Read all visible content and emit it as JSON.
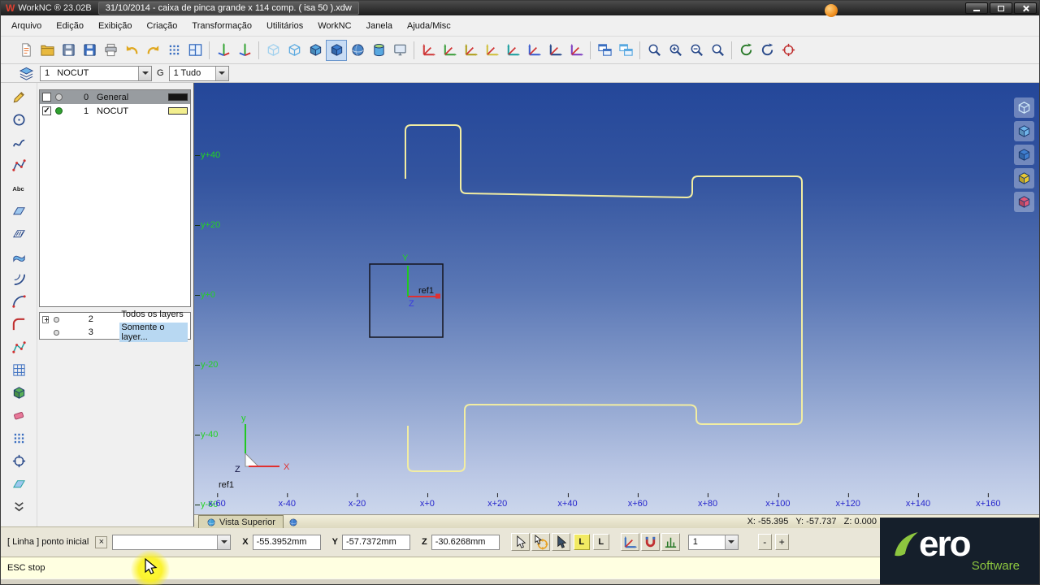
{
  "window": {
    "app_icon_glyph": "W",
    "app_title": "WorkNC ® 23.02B",
    "doc_title": "31/10/2014 - caixa de pinca grande x 114 comp. ( isa 50 ).xdw"
  },
  "menu": {
    "items": [
      "Arquivo",
      "Edição",
      "Exibição",
      "Criação",
      "Transformação",
      "Utilitários",
      "WorkNC",
      "Janela",
      "Ajuda/Misc"
    ]
  },
  "toolbar_main": {
    "icons": [
      {
        "n": "new-file-button",
        "s": "page",
        "c": "#e86820"
      },
      {
        "n": "open-file-button",
        "s": "folder",
        "c": "#e8b93e"
      },
      {
        "n": "save-as-button",
        "s": "floppy",
        "c": "#7a8ca8"
      },
      {
        "n": "save-button",
        "s": "floppy",
        "c": "#3a6ec0"
      },
      {
        "n": "print-button",
        "s": "printer",
        "c": "#b9bec6"
      },
      {
        "n": "undo-button",
        "s": "undo",
        "c": "#e0a820"
      },
      {
        "n": "redo-button",
        "s": "redo",
        "c": "#e0a820"
      },
      {
        "n": "snap-grid-button",
        "s": "dotgrid",
        "c": "#3a6ec0"
      },
      {
        "n": "viewport-layout-button",
        "s": "layout",
        "c": "#3a6ec0"
      },
      {
        "sep": true
      },
      {
        "n": "axes-xyz-button",
        "s": "axes",
        "c": "#333333"
      },
      {
        "n": "axes-uvw-button",
        "s": "axes",
        "c": "#555555"
      },
      {
        "sep": true
      },
      {
        "n": "view-wireframe-button",
        "s": "cubewire",
        "c": "#9fd0ee"
      },
      {
        "n": "view-hidden-line-button",
        "s": "cubewire",
        "c": "#58a8e0"
      },
      {
        "n": "view-shaded-button",
        "s": "cube",
        "c": "#58a8e0"
      },
      {
        "n": "view-shaded-edges-button",
        "s": "cube",
        "c": "#3f7fd0",
        "pressed": true
      },
      {
        "n": "view-sphere-button",
        "s": "sphere",
        "c": "#4a86c8"
      },
      {
        "n": "view-cylinder-button",
        "s": "cyl",
        "c": "#58a8e0"
      },
      {
        "n": "view-screen-button",
        "s": "screen",
        "c": "#667788"
      },
      {
        "sep": true
      },
      {
        "n": "transform-translate-button",
        "s": "axes2",
        "c": "#d04040"
      },
      {
        "n": "transform-rotate-button",
        "s": "axes2",
        "c": "#40a040"
      },
      {
        "n": "transform-scale-button",
        "s": "axes2",
        "c": "#b0a020"
      },
      {
        "n": "transform-mirror-button",
        "s": "axes2",
        "c": "#d0c040"
      },
      {
        "n": "transform-project-button",
        "s": "axes2",
        "c": "#20a0a0"
      },
      {
        "n": "transform-align-button",
        "s": "axes2",
        "c": "#4060d0"
      },
      {
        "n": "transform-array-button",
        "s": "axes2",
        "c": "#2a4a8a"
      },
      {
        "n": "transform-offset-button",
        "s": "axes2",
        "c": "#8040c0"
      },
      {
        "sep": true
      },
      {
        "n": "window-tile-button",
        "s": "winpair",
        "c": "#3a6ec0"
      },
      {
        "n": "window-new-button",
        "s": "winpair",
        "c": "#58a8e0"
      },
      {
        "sep": true
      },
      {
        "n": "zoom-window-button",
        "s": "zoom",
        "c": "#2a4a8a"
      },
      {
        "n": "zoom-in-button",
        "s": "zoomin",
        "c": "#2a4a8a"
      },
      {
        "n": "zoom-out-button",
        "s": "zoomout",
        "c": "#2a4a8a"
      },
      {
        "n": "zoom-fit-button",
        "s": "zoom",
        "c": "#2a4a8a"
      },
      {
        "sep": true
      },
      {
        "n": "rotate-view-button",
        "s": "rotate",
        "c": "#2a7a2a"
      },
      {
        "n": "spin-view-button",
        "s": "rotate",
        "c": "#2a4a8a"
      },
      {
        "n": "center-view-button",
        "s": "target",
        "c": "#c03030"
      }
    ]
  },
  "layer_bar": {
    "layer_value": "1   NOCUT",
    "group_label": "G",
    "group_value": "1 Tudo"
  },
  "left_tools": {
    "icons": [
      {
        "n": "pencil-tool",
        "s": "pencil",
        "c": "#806020"
      },
      {
        "n": "circle-tool",
        "s": "circlet",
        "c": "#2a4a8a"
      },
      {
        "n": "spline-tool",
        "s": "spline",
        "c": "#2a4a8a"
      },
      {
        "n": "polyline-tool",
        "s": "polyline",
        "c": "#2a4a8a"
      },
      {
        "n": "text-tool",
        "s": "abc",
        "c": "#222222"
      },
      {
        "n": "plane-tool",
        "s": "plane",
        "c": "#2a4a8a"
      },
      {
        "n": "hatch-tool",
        "s": "hatch",
        "c": "#2a4a8a"
      },
      {
        "n": "surface-tool",
        "s": "wave",
        "c": "#2a4a8a"
      },
      {
        "n": "offset-tool",
        "s": "offset",
        "c": "#2a4a8a"
      },
      {
        "n": "arc-tool",
        "s": "arc",
        "c": "#2a4a8a"
      },
      {
        "n": "fillet-tool",
        "s": "fillet",
        "c": "#c03030"
      },
      {
        "n": "trim-tool",
        "s": "polyline",
        "c": "#20a0a0"
      },
      {
        "n": "mesh-tool",
        "s": "mesh",
        "c": "#3a6ec0"
      },
      {
        "n": "solid-tool",
        "s": "cube",
        "c": "#58b058"
      },
      {
        "n": "eraser-tool",
        "s": "eraser",
        "c": "#e87898"
      },
      {
        "n": "pattern-tool",
        "s": "dotgrid",
        "c": "#3a6ec0"
      },
      {
        "n": "measure-tool",
        "s": "target",
        "c": "#2a4a8a"
      },
      {
        "n": "section-tool",
        "s": "plane",
        "c": "#20a0a0"
      },
      {
        "n": "more-tools-button",
        "s": "chevdown",
        "c": "#444444"
      }
    ]
  },
  "layers_panel": {
    "rows": [
      {
        "num": "0",
        "name": "General",
        "checked": false,
        "swatch": "#151515"
      },
      {
        "num": "1",
        "name": "NOCUT",
        "checked": true,
        "swatch": "#f2ee8e"
      }
    ]
  },
  "layer_scope": {
    "rows": [
      {
        "num": "2",
        "label": "Todos os layers ..."
      },
      {
        "num": "3",
        "label": "Somente o layer..."
      }
    ]
  },
  "viewport": {
    "y_axis_labels": [
      "y+40",
      "y+20",
      "y+0",
      "y-20",
      "y-40",
      "y-60"
    ],
    "x_axis_labels": [
      "x-60",
      "x-40",
      "x-20",
      "x+0",
      "x+20",
      "x+40",
      "x+60",
      "x+80",
      "x+100",
      "x+120",
      "x+140",
      "x+160"
    ],
    "ref_box": {
      "y_label": "Y",
      "z_label": "Z",
      "name": "ref1"
    },
    "origin_triad": {
      "x_label": "X",
      "y_label": "y",
      "z_label": "Z",
      "name": "ref1"
    },
    "tab_label": "Vista Superior",
    "coord_status": "X: -55.395   Y: -57.737   Z: 0.000"
  },
  "right_view_icons": [
    {
      "n": "iso-view-button",
      "s": "cubewire",
      "c": "#cfe8f8"
    },
    {
      "n": "front-view-button",
      "s": "cube",
      "c": "#6fb3e8"
    },
    {
      "n": "side-view-button",
      "s": "cube",
      "c": "#3f7fd0"
    },
    {
      "n": "top-view-button",
      "s": "cube",
      "c": "#e8c832"
    },
    {
      "n": "back-view-button",
      "s": "cube",
      "c": "#e05878"
    }
  ],
  "command_bar": {
    "prompt": "[ Linha ] ponto inicial",
    "close_glyph": "×",
    "combo_value": "",
    "x_label": "X",
    "x_value": "-55.3952mm",
    "y_label": "Y",
    "y_value": "-57.7372mm",
    "z_label": "Z",
    "z_value": "-30.6268mm",
    "cursor_icons": [
      {
        "n": "select-arrow-button",
        "s": "cursor",
        "c": "#f0f0f0"
      },
      {
        "n": "snap-target-button",
        "s": "cursortarget",
        "c": "#e8a020"
      },
      {
        "n": "pick-filter-button",
        "s": "cursor",
        "c": "#3a5068"
      }
    ],
    "lock_a": "L",
    "lock_b": "L",
    "mode_icons": [
      {
        "n": "coord-system-button",
        "s": "axes2",
        "c": "#3a6ec0"
      },
      {
        "n": "magnet-snap-button",
        "s": "snap",
        "c": "#c03030"
      },
      {
        "n": "level-snap-button",
        "s": "level",
        "c": "#2a7a2a"
      }
    ],
    "copies_value": "1",
    "minus_label": "-",
    "plus_label": "+"
  },
  "status_bar": {
    "message": "ESC stop"
  },
  "logo": {
    "brand_text": "ero",
    "subtitle": "Software"
  }
}
